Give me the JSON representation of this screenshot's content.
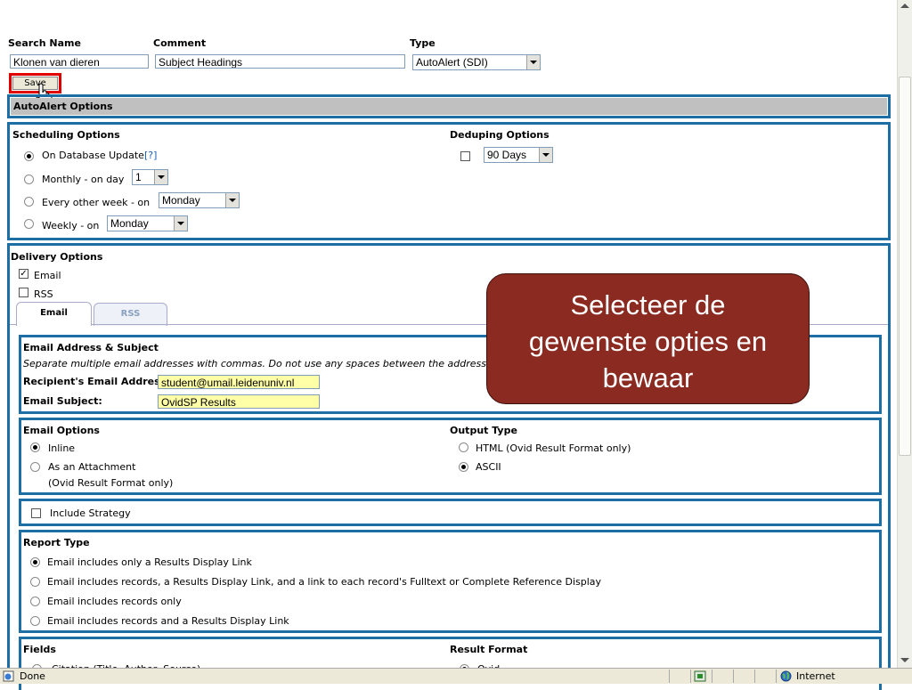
{
  "top": {
    "search_name_label": "Search Name",
    "comment_label": "Comment",
    "type_label": "Type",
    "search_name_value": "Klonen van dieren",
    "comment_value": "Subject Headings",
    "type_value": "AutoAlert (SDI)",
    "save_label": "Save"
  },
  "autoalert": {
    "header": "AutoAlert Options"
  },
  "scheduling": {
    "title": "Scheduling Options",
    "options": [
      {
        "label": "On Database Update",
        "help": "[?]",
        "checked": true
      },
      {
        "label": "Monthly - on day",
        "select": "1",
        "checked": false
      },
      {
        "label": "Every other week - on",
        "select": "Monday",
        "checked": false
      },
      {
        "label": "Weekly - on",
        "select": "Monday",
        "checked": false
      }
    ]
  },
  "deduping": {
    "title": "Deduping Options",
    "select": "90 Days"
  },
  "delivery": {
    "title": "Delivery Options",
    "email_label": "Email",
    "rss_label": "RSS",
    "tabs": [
      "Email",
      "RSS"
    ]
  },
  "email_address": {
    "title": "Email Address & Subject",
    "note": "Separate multiple email addresses with commas. Do not use any spaces between the addresses.",
    "recipient_label": "Recipient's Email Address:",
    "recipient_value": "student@umail.leidenuniv.nl",
    "subject_label": "Email Subject:",
    "subject_value": "OvidSP Results"
  },
  "email_options": {
    "title": "Email Options",
    "inline": "Inline",
    "attachment": "As an Attachment",
    "attachment_note": "(Ovid Result Format only)"
  },
  "output_type": {
    "title": "Output Type",
    "html": "HTML (Ovid Result Format only)",
    "ascii": "ASCII"
  },
  "include_strategy": "Include Strategy",
  "report_type": {
    "title": "Report Type",
    "options": [
      "Email includes only a Results Display Link",
      "Email includes records, a Results Display Link, and a link to each record's Fulltext or Complete Reference Display",
      "Email includes records only",
      "Email includes records and a Results Display Link"
    ]
  },
  "fields": {
    "title": "Fields",
    "first_option": "Citation (Title, Author, Source)"
  },
  "result_format": {
    "title": "Result Format",
    "first_option": "Ovid"
  },
  "callout": {
    "line1": "Selecteer de",
    "line2": "gewenste opties en",
    "line3": "bewaar"
  },
  "status": {
    "text": "Done",
    "zone": "Internet"
  },
  "colors": {
    "panel_border": "#1e6ea6",
    "callout_bg": "#8a2a20",
    "highlight": "#ffffa8",
    "save_outline": "#e00000"
  }
}
